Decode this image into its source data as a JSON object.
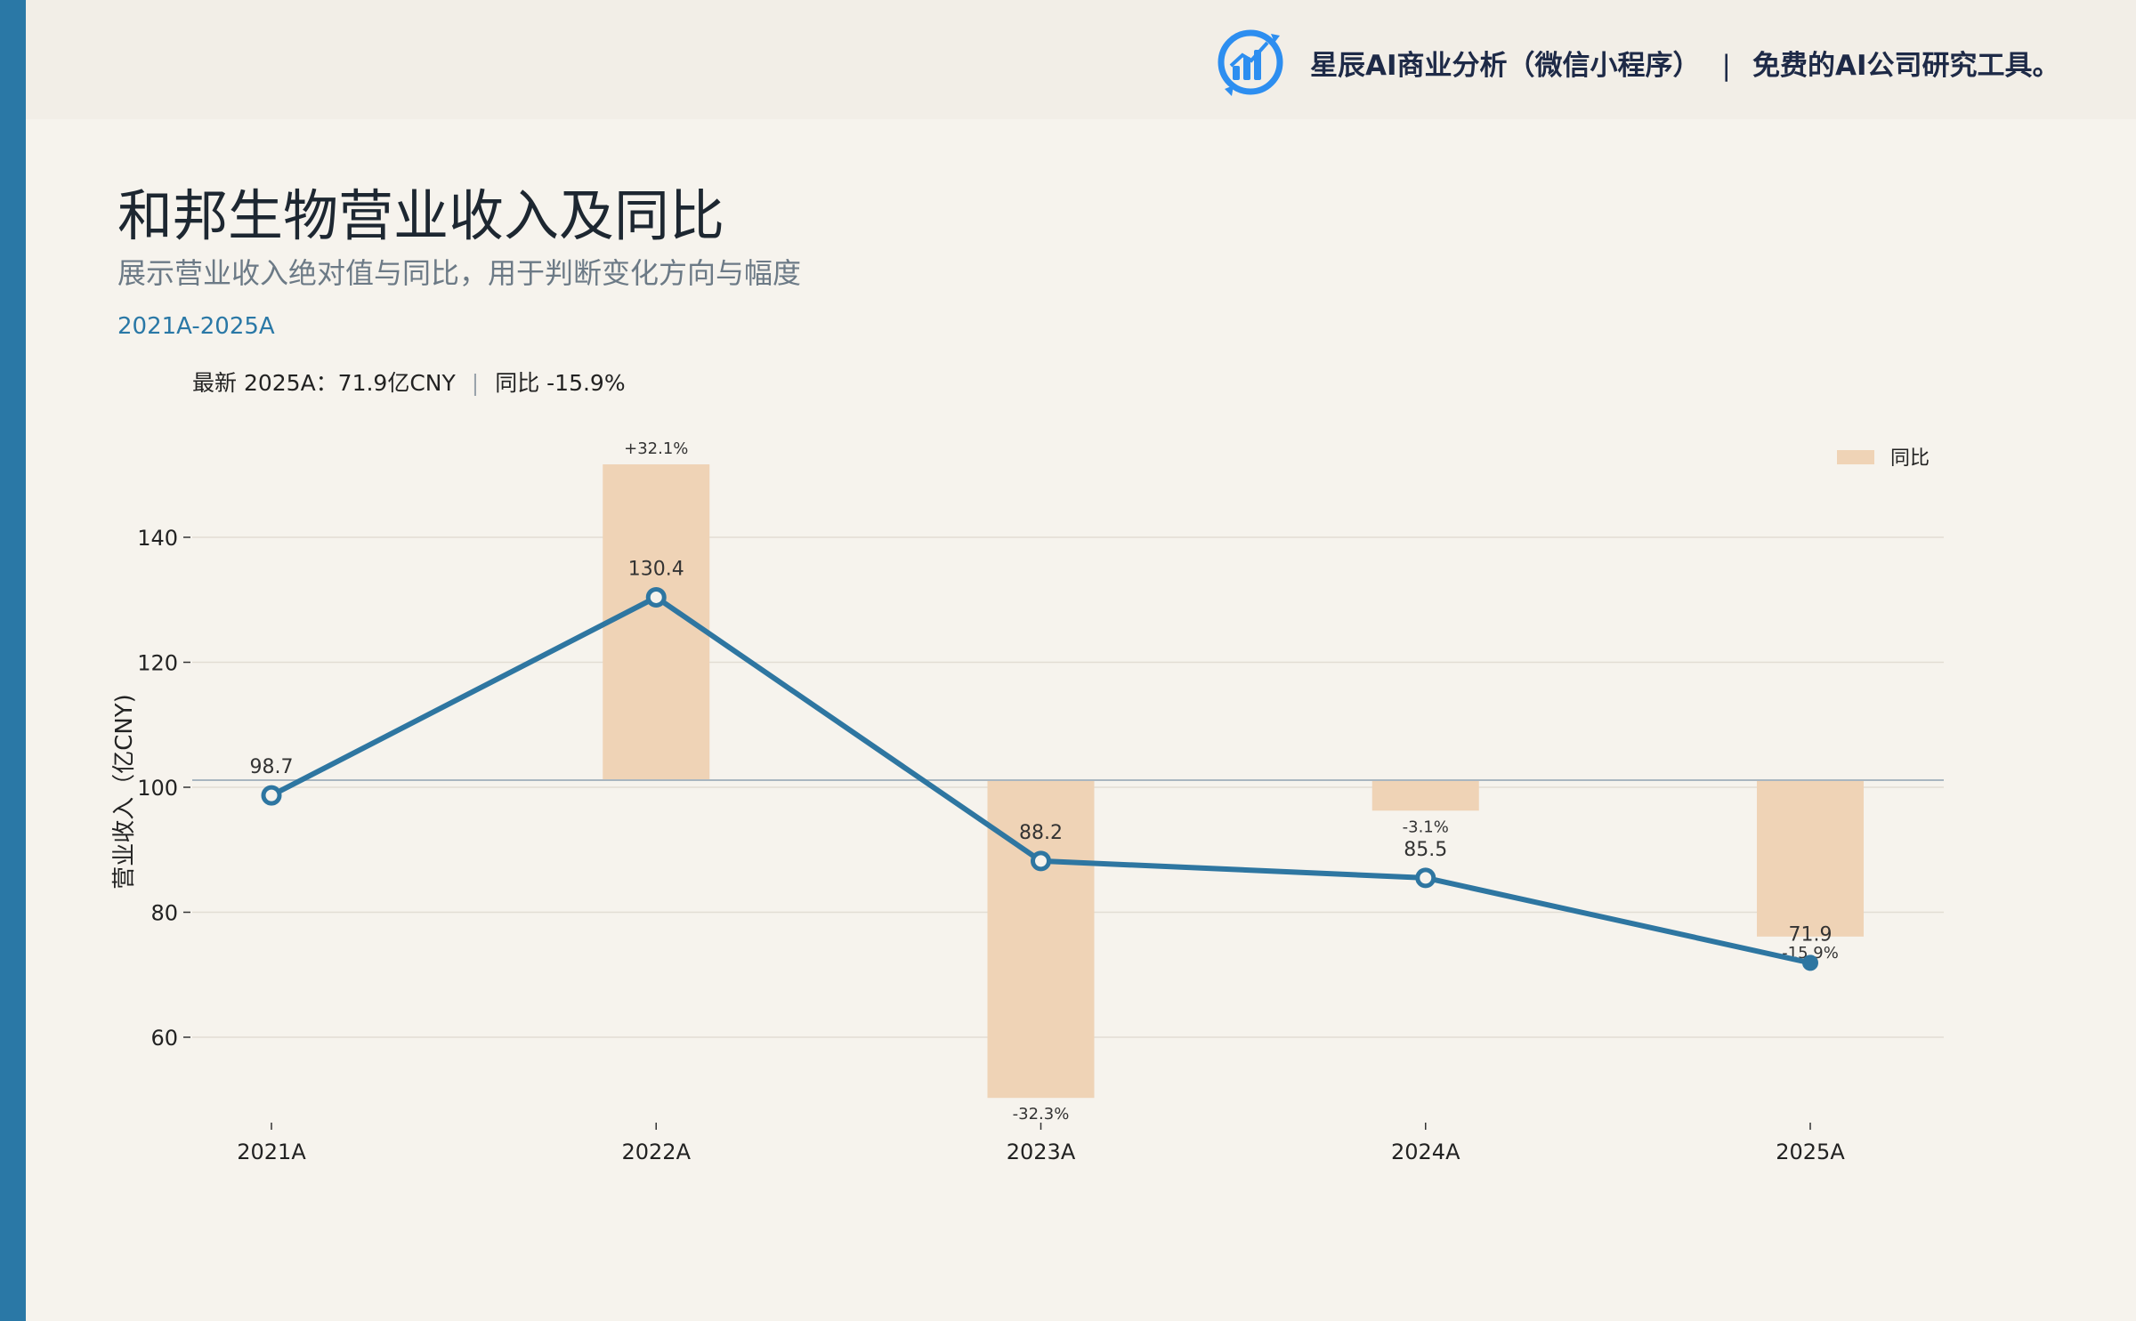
{
  "brand": {
    "name": "星辰AI商业分析（微信小程序）",
    "separator": "|",
    "tagline": "免费的AI公司研究工具。",
    "logo_icon": "bar-chart-refresh-icon"
  },
  "header": {
    "title": "和邦生物营业收入及同比",
    "subtitle": "展示营业收入绝对值与同比，用于判断变化方向与幅度",
    "period": "2021A-2025A",
    "latest_label": "最新 2025A：71.9亿CNY",
    "latest_sep": "|",
    "latest_yoy": "同比 -15.9%"
  },
  "colors": {
    "accent": "#2a78a6",
    "line": "#2e76a1",
    "bar": "#efd3b6",
    "background": "#f6f3ed"
  },
  "chart_data": {
    "type": "line",
    "categories": [
      "2021A",
      "2022A",
      "2023A",
      "2024A",
      "2025A"
    ],
    "ylabel": "营业收入（亿CNY)",
    "ylim": [
      45,
      157
    ],
    "yticks": [
      60,
      80,
      100,
      120,
      140
    ],
    "grid": true,
    "series": [
      {
        "type": "line",
        "values": [
          98.7,
          130.4,
          88.2,
          85.5,
          71.9
        ],
        "labels": [
          "98.7",
          "130.4",
          "88.2",
          "85.5",
          "71.9"
        ]
      },
      {
        "type": "bar",
        "name": "同比",
        "values": [
          null,
          32.1,
          -32.3,
          -3.1,
          -15.9
        ],
        "labels": [
          "",
          "+32.1%",
          "-32.3%",
          "-3.1%",
          "-15.9%"
        ]
      }
    ],
    "legend": {
      "position": "top-right",
      "entries": [
        "同比"
      ]
    }
  }
}
